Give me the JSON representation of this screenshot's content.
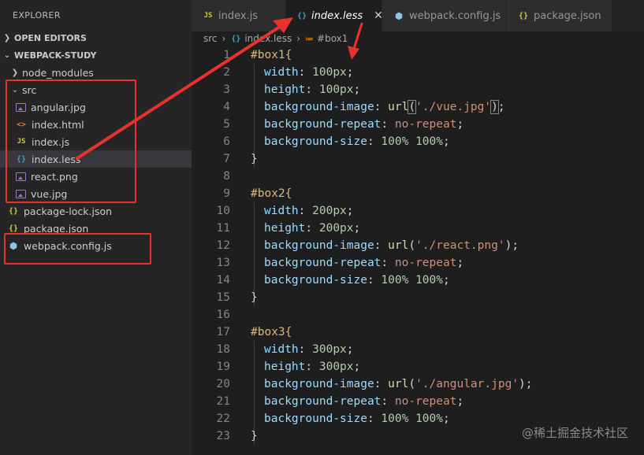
{
  "sidebar": {
    "title": "EXPLORER",
    "open_editors": "OPEN EDITORS",
    "project": "WEBPACK-STUDY",
    "node_modules": "node_modules",
    "src": "src",
    "files": {
      "angular": "angular.jpg",
      "index_html": "index.html",
      "index_js": "index.js",
      "index_less": "index.less",
      "react": "react.png",
      "vue": "vue.jpg"
    },
    "package_lock": "package-lock.json",
    "package_json": "package.json",
    "webpack_config": "webpack.config.js"
  },
  "tabs": {
    "t1": "index.js",
    "t2": "index.less",
    "t3": "webpack.config.js",
    "t4": "package.json"
  },
  "breadcrumb": {
    "folder": "src",
    "file": "index.less",
    "symbol": "#box1"
  },
  "code": {
    "l1": "#box1{",
    "l2p": "width",
    "l2v": "100px",
    "l3p": "height",
    "l3v": "100px",
    "l4p": "background-image",
    "l4s": "'./vue.jpg'",
    "l5p": "background-repeat",
    "l5v": "no-repeat",
    "l6p": "background-size",
    "l6v": "100% 100%",
    "l7": "}",
    "l9": "#box2{",
    "l10p": "width",
    "l10v": "200px",
    "l11p": "height",
    "l11v": "200px",
    "l12p": "background-image",
    "l12s": "'./react.png'",
    "l13p": "background-repeat",
    "l13v": "no-repeat",
    "l14p": "background-size",
    "l14v": "100% 100%",
    "l15": "}",
    "l17": "#box3{",
    "l18p": "width",
    "l18v": "300px",
    "l19p": "height",
    "l19v": "300px",
    "l20p": "background-image",
    "l20s": "'./angular.jpg'",
    "l21p": "background-repeat",
    "l21v": "no-repeat",
    "l22p": "background-size",
    "l22v": "100% 100%",
    "l23": "}"
  },
  "line_numbers": [
    "1",
    "2",
    "3",
    "4",
    "5",
    "6",
    "7",
    "8",
    "9",
    "10",
    "11",
    "12",
    "13",
    "14",
    "15",
    "16",
    "17",
    "18",
    "19",
    "20",
    "21",
    "22",
    "23"
  ],
  "watermark": "@稀土掘金技术社区",
  "colors": {
    "annotation_red": "#e8322e",
    "editor_bg": "#1e1e1e",
    "sidebar_bg": "#252526"
  }
}
